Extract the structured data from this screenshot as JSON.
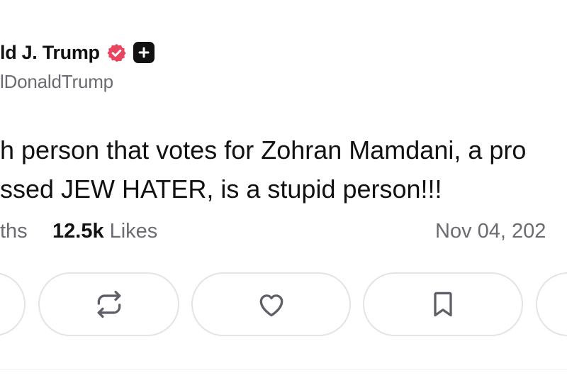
{
  "post": {
    "display_name": "ld J. Trump",
    "handle": "lDonaldTrump",
    "text_lines": [
      "h person that votes for Zohran Mamdani, a pro",
      "ssed JEW HATER, is a stupid person!!!"
    ]
  },
  "stats": {
    "reposts_label": "ths",
    "likes_count": "12.5k",
    "likes_label": "Likes",
    "date": "Nov 04, 202"
  },
  "icons": {
    "verified": "verified-badge-icon",
    "plus_badge": "plus-badge-icon",
    "repost": "repost-icon",
    "like": "heart-icon",
    "bookmark": "bookmark-icon"
  },
  "colors": {
    "verified_badge": "#E8455F",
    "text_primary": "#111111",
    "text_muted": "#6B6B73",
    "button_border": "#E3E3E8",
    "icon_stroke": "#5F5F68"
  }
}
